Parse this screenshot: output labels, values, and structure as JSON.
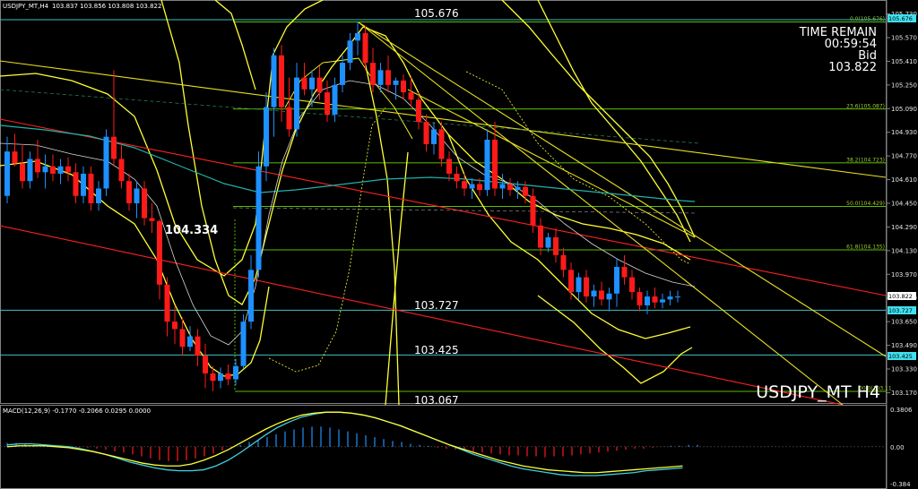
{
  "header": {
    "symbol_tf": "USDJPY_MT,H4",
    "ohlc": "103.837 103.856 103.808 103.822"
  },
  "info_panel": {
    "time_remain_label": "TIME REMAIN",
    "time_remain": "00:59:54",
    "bid_label": "Bid",
    "bid": "103.822"
  },
  "watermark": "USDJPY_MT H4",
  "price_labels": {
    "high_label": "105.676",
    "left_level": "104.334",
    "level_1": "103.727",
    "level_2": "103.425",
    "low_label": "103.067"
  },
  "axis_tags": {
    "top": "105.676",
    "current": "103.822",
    "level_1": "103.727",
    "level_2": "103.425"
  },
  "fib_labels": [
    "0.0(105.676)",
    "23.6(105.087)",
    "38.2(104.723)",
    "50.0(104.429)",
    "61.8(104.135)",
    "00.0(103.11"
  ],
  "macd_header": "MACD(12,26,9) -0.1770 -0.2066 0.0295 0.0000",
  "macd_ticks": [
    "0.3806",
    "0.00",
    "-0.384"
  ],
  "colors": {
    "background": "#000000",
    "bull": "#1e90ff",
    "bear": "#ff1a1a",
    "bands": "#ffff33",
    "ma": "#20b2aa",
    "trend_red": "#ff2020",
    "trend_yellow": "#e8e020",
    "fib": "#7cfc00",
    "hline": "#40c0c0",
    "tag_cyan": "#40e0f0"
  },
  "chart_data": {
    "type": "candlestick",
    "ylim": [
      103.1,
      105.8
    ],
    "y_ticks": [
      105.73,
      105.57,
      105.41,
      105.25,
      105.09,
      104.93,
      104.77,
      104.61,
      104.45,
      104.29,
      104.13,
      103.97,
      103.81,
      103.65,
      103.49,
      103.33,
      103.17
    ],
    "candles": [
      {
        "o": 104.5,
        "h": 104.9,
        "l": 104.45,
        "c": 104.8
      },
      {
        "o": 104.8,
        "h": 104.92,
        "l": 104.7,
        "c": 104.72
      },
      {
        "o": 104.72,
        "h": 104.85,
        "l": 104.55,
        "c": 104.6
      },
      {
        "o": 104.6,
        "h": 104.8,
        "l": 104.55,
        "c": 104.75
      },
      {
        "o": 104.75,
        "h": 104.88,
        "l": 104.62,
        "c": 104.66
      },
      {
        "o": 104.66,
        "h": 104.78,
        "l": 104.55,
        "c": 104.7
      },
      {
        "o": 104.7,
        "h": 104.78,
        "l": 104.6,
        "c": 104.65
      },
      {
        "o": 104.65,
        "h": 104.75,
        "l": 104.58,
        "c": 104.7
      },
      {
        "o": 104.7,
        "h": 104.76,
        "l": 104.6,
        "c": 104.66
      },
      {
        "o": 104.66,
        "h": 104.72,
        "l": 104.45,
        "c": 104.5
      },
      {
        "o": 104.5,
        "h": 104.7,
        "l": 104.45,
        "c": 104.65
      },
      {
        "o": 104.65,
        "h": 104.7,
        "l": 104.4,
        "c": 104.45
      },
      {
        "o": 104.45,
        "h": 104.6,
        "l": 104.4,
        "c": 104.55
      },
      {
        "o": 104.55,
        "h": 104.95,
        "l": 104.5,
        "c": 104.9
      },
      {
        "o": 104.9,
        "h": 105.35,
        "l": 104.7,
        "c": 104.75
      },
      {
        "o": 104.75,
        "h": 104.85,
        "l": 104.55,
        "c": 104.6
      },
      {
        "o": 104.6,
        "h": 104.65,
        "l": 104.4,
        "c": 104.45
      },
      {
        "o": 104.45,
        "h": 104.6,
        "l": 104.35,
        "c": 104.55
      },
      {
        "o": 104.55,
        "h": 104.6,
        "l": 104.3,
        "c": 104.35
      },
      {
        "o": 104.35,
        "h": 104.45,
        "l": 104.25,
        "c": 104.33
      },
      {
        "o": 104.33,
        "h": 104.34,
        "l": 103.8,
        "c": 103.9
      },
      {
        "o": 103.9,
        "h": 103.95,
        "l": 103.55,
        "c": 103.65
      },
      {
        "o": 103.65,
        "h": 103.75,
        "l": 103.5,
        "c": 103.6
      },
      {
        "o": 103.6,
        "h": 103.68,
        "l": 103.42,
        "c": 103.48
      },
      {
        "o": 103.48,
        "h": 103.62,
        "l": 103.45,
        "c": 103.55
      },
      {
        "o": 103.55,
        "h": 103.6,
        "l": 103.35,
        "c": 103.42
      },
      {
        "o": 103.42,
        "h": 103.5,
        "l": 103.2,
        "c": 103.3
      },
      {
        "o": 103.3,
        "h": 103.35,
        "l": 103.18,
        "c": 103.25
      },
      {
        "o": 103.25,
        "h": 103.34,
        "l": 103.2,
        "c": 103.3
      },
      {
        "o": 103.3,
        "h": 103.36,
        "l": 103.22,
        "c": 103.26
      },
      {
        "o": 103.26,
        "h": 103.4,
        "l": 103.22,
        "c": 103.35
      },
      {
        "o": 103.35,
        "h": 103.7,
        "l": 103.33,
        "c": 103.65
      },
      {
        "o": 103.65,
        "h": 104.1,
        "l": 103.6,
        "c": 104.0
      },
      {
        "o": 104.0,
        "h": 104.8,
        "l": 103.95,
        "c": 104.7
      },
      {
        "o": 104.7,
        "h": 105.2,
        "l": 104.6,
        "c": 105.1
      },
      {
        "o": 105.1,
        "h": 105.5,
        "l": 104.9,
        "c": 105.45
      },
      {
        "o": 105.45,
        "h": 105.52,
        "l": 105.0,
        "c": 105.1
      },
      {
        "o": 105.1,
        "h": 105.3,
        "l": 104.9,
        "c": 104.95
      },
      {
        "o": 104.95,
        "h": 105.4,
        "l": 104.9,
        "c": 105.3
      },
      {
        "o": 105.3,
        "h": 105.4,
        "l": 105.18,
        "c": 105.22
      },
      {
        "o": 105.22,
        "h": 105.35,
        "l": 105.1,
        "c": 105.3
      },
      {
        "o": 105.3,
        "h": 105.38,
        "l": 105.15,
        "c": 105.2
      },
      {
        "o": 105.2,
        "h": 105.28,
        "l": 105.0,
        "c": 105.05
      },
      {
        "o": 105.05,
        "h": 105.3,
        "l": 105.0,
        "c": 105.25
      },
      {
        "o": 105.25,
        "h": 105.45,
        "l": 105.2,
        "c": 105.4
      },
      {
        "o": 105.4,
        "h": 105.6,
        "l": 105.35,
        "c": 105.55
      },
      {
        "o": 105.55,
        "h": 105.68,
        "l": 105.45,
        "c": 105.6
      },
      {
        "o": 105.6,
        "h": 105.65,
        "l": 105.35,
        "c": 105.4
      },
      {
        "o": 105.4,
        "h": 105.5,
        "l": 105.2,
        "c": 105.25
      },
      {
        "o": 105.25,
        "h": 105.4,
        "l": 105.2,
        "c": 105.35
      },
      {
        "o": 105.35,
        "h": 105.45,
        "l": 105.2,
        "c": 105.25
      },
      {
        "o": 105.25,
        "h": 105.3,
        "l": 105.15,
        "c": 105.28
      },
      {
        "o": 105.28,
        "h": 105.32,
        "l": 105.15,
        "c": 105.2
      },
      {
        "o": 105.2,
        "h": 105.3,
        "l": 105.1,
        "c": 105.15
      },
      {
        "o": 105.15,
        "h": 105.2,
        "l": 104.95,
        "c": 105.0
      },
      {
        "o": 105.0,
        "h": 105.05,
        "l": 104.8,
        "c": 104.85
      },
      {
        "o": 104.85,
        "h": 105.0,
        "l": 104.78,
        "c": 104.95
      },
      {
        "o": 104.95,
        "h": 105.0,
        "l": 104.7,
        "c": 104.75
      },
      {
        "o": 104.75,
        "h": 104.8,
        "l": 104.6,
        "c": 104.65
      },
      {
        "o": 104.65,
        "h": 104.7,
        "l": 104.55,
        "c": 104.6
      },
      {
        "o": 104.6,
        "h": 104.65,
        "l": 104.5,
        "c": 104.55
      },
      {
        "o": 104.55,
        "h": 104.62,
        "l": 104.48,
        "c": 104.58
      },
      {
        "o": 104.58,
        "h": 104.62,
        "l": 104.5,
        "c": 104.54
      },
      {
        "o": 104.54,
        "h": 104.95,
        "l": 104.5,
        "c": 104.88
      },
      {
        "o": 104.88,
        "h": 105.0,
        "l": 104.5,
        "c": 104.55
      },
      {
        "o": 104.55,
        "h": 104.65,
        "l": 104.48,
        "c": 104.58
      },
      {
        "o": 104.58,
        "h": 104.62,
        "l": 104.5,
        "c": 104.54
      },
      {
        "o": 104.54,
        "h": 104.6,
        "l": 104.48,
        "c": 104.56
      },
      {
        "o": 104.56,
        "h": 104.6,
        "l": 104.45,
        "c": 104.5
      },
      {
        "o": 104.5,
        "h": 104.55,
        "l": 104.25,
        "c": 104.3
      },
      {
        "o": 104.3,
        "h": 104.35,
        "l": 104.1,
        "c": 104.15
      },
      {
        "o": 104.15,
        "h": 104.25,
        "l": 104.12,
        "c": 104.22
      },
      {
        "o": 104.22,
        "h": 104.28,
        "l": 104.05,
        "c": 104.1
      },
      {
        "o": 104.1,
        "h": 104.15,
        "l": 103.95,
        "c": 104.0
      },
      {
        "o": 104.0,
        "h": 104.05,
        "l": 103.8,
        "c": 103.85
      },
      {
        "o": 103.85,
        "h": 103.98,
        "l": 103.8,
        "c": 103.95
      },
      {
        "o": 103.95,
        "h": 104.0,
        "l": 103.78,
        "c": 103.82
      },
      {
        "o": 103.82,
        "h": 103.9,
        "l": 103.75,
        "c": 103.86
      },
      {
        "o": 103.86,
        "h": 103.92,
        "l": 103.76,
        "c": 103.8
      },
      {
        "o": 103.8,
        "h": 103.88,
        "l": 103.72,
        "c": 103.84
      },
      {
        "o": 103.84,
        "h": 104.08,
        "l": 103.75,
        "c": 104.02
      },
      {
        "o": 104.02,
        "h": 104.1,
        "l": 103.9,
        "c": 103.95
      },
      {
        "o": 103.95,
        "h": 104.0,
        "l": 103.8,
        "c": 103.85
      },
      {
        "o": 103.85,
        "h": 103.88,
        "l": 103.72,
        "c": 103.76
      },
      {
        "o": 103.76,
        "h": 103.86,
        "l": 103.7,
        "c": 103.82
      },
      {
        "o": 103.82,
        "h": 103.88,
        "l": 103.74,
        "c": 103.78
      },
      {
        "o": 103.78,
        "h": 103.84,
        "l": 103.74,
        "c": 103.8
      },
      {
        "o": 103.8,
        "h": 103.86,
        "l": 103.76,
        "c": 103.82
      },
      {
        "o": 103.82,
        "h": 103.86,
        "l": 103.78,
        "c": 103.82
      }
    ],
    "horizontal_levels": [
      {
        "label": "105.676",
        "value": 105.676
      },
      {
        "label": "103.727",
        "value": 103.727
      },
      {
        "label": "103.425",
        "value": 103.425
      }
    ],
    "fib_levels": [
      {
        "label": "0.0(105.676)",
        "value": 105.676
      },
      {
        "label": "23.6(105.087)",
        "value": 105.087
      },
      {
        "label": "38.2(104.723)",
        "value": 104.723
      },
      {
        "label": "50.0(104.429)",
        "value": 104.429
      },
      {
        "label": "61.8(104.135)",
        "value": 104.135
      }
    ],
    "macd": {
      "ylim": [
        -0.384,
        0.3806
      ],
      "ticks": [
        0.3806,
        0.0,
        -0.384
      ],
      "histogram": [
        0.04,
        0.04,
        0.03,
        0.02,
        0.02,
        0.01,
        0.01,
        0.0,
        -0.01,
        -0.01,
        -0.02,
        -0.03,
        -0.05,
        -0.06,
        -0.08,
        -0.1,
        -0.12,
        -0.14,
        -0.15,
        -0.15,
        -0.14,
        -0.12,
        -0.1,
        -0.07,
        -0.04,
        -0.01,
        0.02,
        0.05,
        0.07,
        0.1,
        0.13,
        0.16,
        0.18,
        0.2,
        0.21,
        0.21,
        0.2,
        0.18,
        0.16,
        0.14,
        0.12,
        0.1,
        0.08,
        0.06,
        0.05,
        0.03,
        0.02,
        0.01,
        -0.01,
        -0.02,
        -0.03,
        -0.04,
        -0.05,
        -0.06,
        -0.07,
        -0.08,
        -0.09,
        -0.09,
        -0.1,
        -0.1,
        -0.11,
        -0.1,
        -0.1,
        -0.09,
        -0.08,
        -0.07,
        -0.06,
        -0.05,
        -0.04,
        -0.03,
        -0.02,
        -0.02,
        -0.01,
        0.0,
        0.01,
        0.01,
        0.02,
        0.02
      ],
      "macd_line": [
        0.02,
        0.03,
        0.03,
        0.02,
        0.01,
        0.0,
        -0.02,
        -0.05,
        -0.08,
        -0.12,
        -0.16,
        -0.19,
        -0.22,
        -0.24,
        -0.25,
        -0.25,
        -0.24,
        -0.2,
        -0.14,
        -0.06,
        0.03,
        0.12,
        0.2,
        0.26,
        0.31,
        0.34,
        0.36,
        0.36,
        0.35,
        0.33,
        0.3,
        0.26,
        0.22,
        0.17,
        0.12,
        0.07,
        0.02,
        -0.03,
        -0.08,
        -0.12,
        -0.16,
        -0.2,
        -0.23,
        -0.25,
        -0.27,
        -0.29,
        -0.3,
        -0.3,
        -0.3,
        -0.29,
        -0.28,
        -0.27,
        -0.25,
        -0.24,
        -0.23,
        -0.22
      ],
      "signal_line": [
        0.0,
        0.01,
        0.01,
        0.01,
        0.0,
        -0.01,
        -0.03,
        -0.05,
        -0.08,
        -0.11,
        -0.14,
        -0.17,
        -0.19,
        -0.2,
        -0.2,
        -0.18,
        -0.14,
        -0.09,
        -0.03,
        0.04,
        0.11,
        0.18,
        0.24,
        0.29,
        0.33,
        0.35,
        0.36,
        0.36,
        0.35,
        0.33,
        0.3,
        0.26,
        0.22,
        0.17,
        0.12,
        0.07,
        0.02,
        -0.02,
        -0.06,
        -0.1,
        -0.14,
        -0.17,
        -0.2,
        -0.22,
        -0.24,
        -0.25,
        -0.26,
        -0.27,
        -0.27,
        -0.26,
        -0.25,
        -0.24,
        -0.23,
        -0.22,
        -0.21,
        -0.2
      ]
    }
  }
}
